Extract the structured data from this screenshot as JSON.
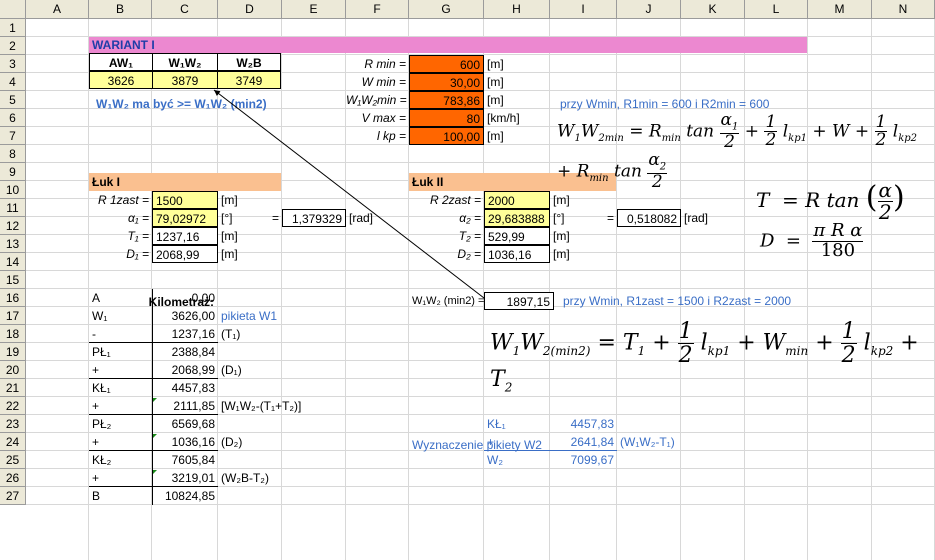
{
  "columns": [
    "A",
    "B",
    "C",
    "D",
    "E",
    "F",
    "G",
    "H",
    "I",
    "J",
    "K",
    "L",
    "M",
    "N"
  ],
  "rows": [
    "1",
    "2",
    "3",
    "4",
    "5",
    "6",
    "7",
    "8",
    "9",
    "10",
    "11",
    "12",
    "13",
    "14",
    "15",
    "16",
    "17",
    "18",
    "19",
    "20",
    "21",
    "22",
    "23",
    "24",
    "25",
    "26",
    "27"
  ],
  "title": "WARIANT I",
  "top_table": {
    "headers": [
      "AW₁",
      "W₁W₂",
      "W₂B"
    ],
    "values": [
      "3626",
      "3879",
      "3749"
    ],
    "note": "W₁W₂ ma być >= W₁W₂ (min2)"
  },
  "params": [
    {
      "label": "R min =",
      "value": "600",
      "unit": "[m]"
    },
    {
      "label": "W min =",
      "value": "30,00",
      "unit": "[m]"
    },
    {
      "label": "W₁W₂min =",
      "value": "783,86",
      "unit": "[m]"
    },
    {
      "label": "V max =",
      "value": "80",
      "unit": "[km/h]"
    },
    {
      "label": "l kp =",
      "value": "100,00",
      "unit": "[m]"
    }
  ],
  "note_rmin": "przy Wmin, R1min = 600 i R2min = 600",
  "arc1": {
    "title": "Łuk I",
    "r_label": "R 1zast =",
    "r_value": "1500",
    "r_unit": "[m]",
    "a_label": "α₁ =",
    "a_value": "79,02972",
    "a_unit": "[°]",
    "eq": "=",
    "rad_value": "1,379329",
    "rad_unit": "[rad]",
    "t_label": "T₁ =",
    "t_value": "1237,16",
    "t_unit": "[m]",
    "d_label": "D₁ =",
    "d_value": "2068,99",
    "d_unit": "[m]"
  },
  "arc2": {
    "title": "Łuk II",
    "r_label": "R 2zast =",
    "r_value": "2000",
    "r_unit": "[m]",
    "a_label": "α₂ =",
    "a_value": "29,683888",
    "a_unit": "[°]",
    "eq": "=",
    "rad_value": "0,518082",
    "rad_unit": "[rad]",
    "t_label": "T₂ =",
    "t_value": "529,99",
    "t_unit": "[m]",
    "d_label": "D₂ =",
    "d_value": "1036,16",
    "d_unit": "[m]"
  },
  "w1w2min": {
    "label": "W₁W₂ (min2) =",
    "value": "1897,15"
  },
  "note_rzast": "przy Wmin, R1zast = 1500 i R2zast = 2000",
  "kilometraz": {
    "title": "Kilometraż:",
    "rows": [
      {
        "label": "A",
        "value": "0,00",
        "note": ""
      },
      {
        "label": "W₁",
        "value": "3626,00",
        "note": "pikieta W1"
      },
      {
        "label": "-",
        "value": "1237,16",
        "note": "(T₁)"
      },
      {
        "label": "PŁ₁",
        "value": "2388,84",
        "note": ""
      },
      {
        "label": "+",
        "value": "2068,99",
        "note": "(D₁)"
      },
      {
        "label": "KŁ₁",
        "value": "4457,83",
        "note": ""
      },
      {
        "label": "+",
        "value": "2111,85",
        "note": "[W₁W₂-(T₁+T₂)]"
      },
      {
        "label": "PŁ₂",
        "value": "6569,68",
        "note": ""
      },
      {
        "label": "+",
        "value": "1036,16",
        "note": "(D₂)"
      },
      {
        "label": "KŁ₂",
        "value": "7605,84",
        "note": ""
      },
      {
        "label": "+",
        "value": "3219,01",
        "note": "(W₂B-T₂)"
      },
      {
        "label": "B",
        "value": "10824,85",
        "note": ""
      }
    ]
  },
  "pikieta": {
    "title": "Wyznaczenie pikiety W2",
    "rows": [
      {
        "label": "KŁ₁",
        "value": "4457,83",
        "note": ""
      },
      {
        "label": "+",
        "value": "2641,84",
        "note": "(W₁W₂-T₁)"
      },
      {
        "label": "W₂",
        "value": "7099,67",
        "note": ""
      }
    ]
  },
  "colors": {
    "title_bar": "#ec88d0",
    "orange": "#ff6600",
    "yellow": "#ffff99",
    "peach": "#fac090",
    "blue_text": "#3a6ec6"
  }
}
